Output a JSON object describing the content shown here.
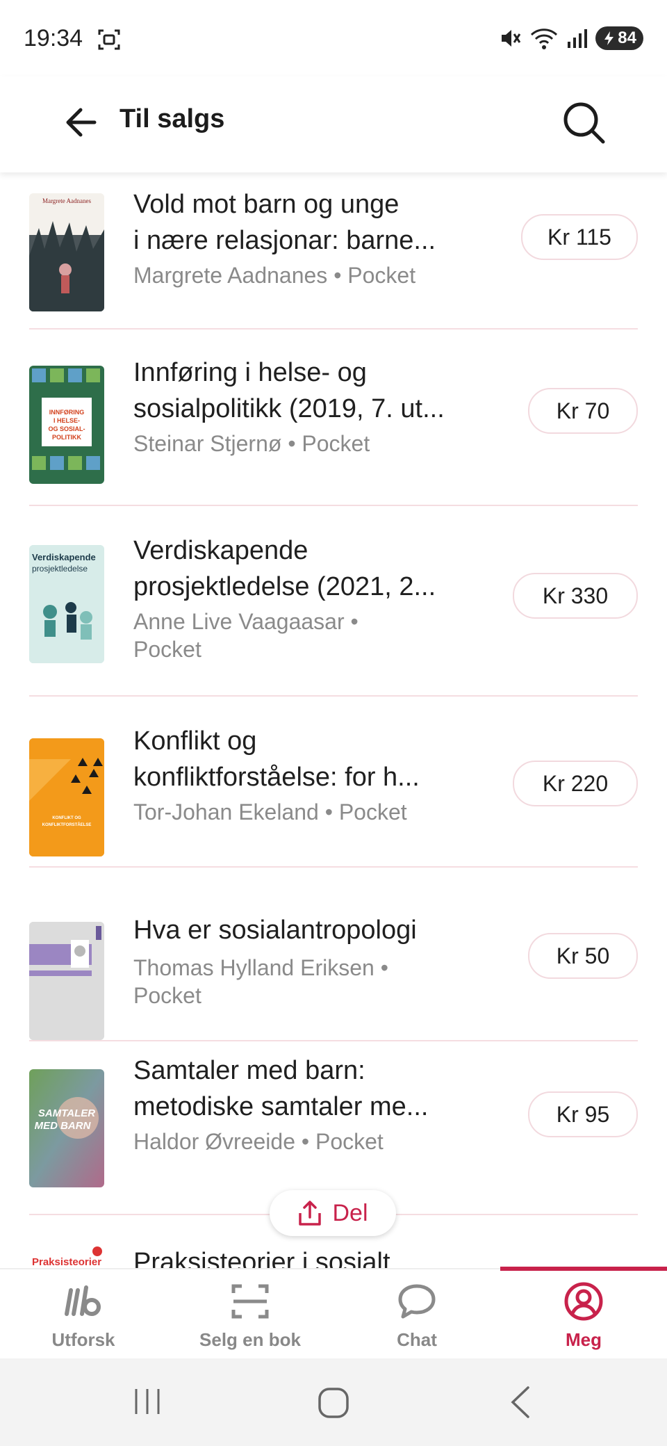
{
  "status_bar": {
    "time": "19:34",
    "battery": "84"
  },
  "header": {
    "title": "Til salgs"
  },
  "listings": [
    {
      "title_line1": "Vold mot barn og unge",
      "title_line2": "i nære relasjonar: barne...",
      "author": "Margrete Aadnanes • Pocket",
      "author_line2": "",
      "price": "Kr 115"
    },
    {
      "title_line1": "Innføring i helse- og",
      "title_line2": "sosialpolitikk (2019, 7. ut...",
      "author": "Steinar Stjernø • Pocket",
      "author_line2": "",
      "price": "Kr 70"
    },
    {
      "title_line1": "Verdiskapende",
      "title_line2": "prosjektledelse (2021, 2...",
      "author": "Anne Live Vaagaasar •",
      "author_line2": "Pocket",
      "price": "Kr 330"
    },
    {
      "title_line1": "Konflikt og",
      "title_line2": "konfliktforståelse: for h...",
      "author": "Tor-Johan Ekeland • Pocket",
      "author_line2": "",
      "price": "Kr 220"
    },
    {
      "title_line1": "Hva er sosialantropologi",
      "title_line2": "",
      "author": "Thomas Hylland Eriksen •",
      "author_line2": "Pocket",
      "price": "Kr 50"
    },
    {
      "title_line1": "Samtaler med barn:",
      "title_line2": "metodiske samtaler me...",
      "author": "Haldor Øvreeide • Pocket",
      "author_line2": "",
      "price": "Kr 95"
    },
    {
      "title_line1": "Praksisteorier i sosialt",
      "title_line2": "",
      "author": "",
      "author_line2": "",
      "price": ""
    }
  ],
  "covers": {
    "c1_author": "Margrete Aadnanes",
    "c1_title": "Vold mot barn og unge i nære relasjonar",
    "c2_title": "INNFØRING I HELSE- OG SOSIAL-POLITIKK",
    "c3_title": "Verdiskapende",
    "c3_sub": "prosjektledelse",
    "c4_title": "KONFLIKT OG KONFLIKTFORSTÅELSE",
    "c6_title": "SAMTALER MED BARN",
    "c7_title": "Praksisteorier"
  },
  "share_button": {
    "label": "Del"
  },
  "bottom_nav": [
    {
      "label": "Utforsk",
      "icon": "explore-logo-icon"
    },
    {
      "label": "Selg en bok",
      "icon": "scan-icon"
    },
    {
      "label": "Chat",
      "icon": "chat-bubble-icon"
    },
    {
      "label": "Meg",
      "icon": "profile-icon",
      "active": true
    }
  ],
  "colors": {
    "accent": "#c8224b",
    "divider": "#f5dde1"
  }
}
